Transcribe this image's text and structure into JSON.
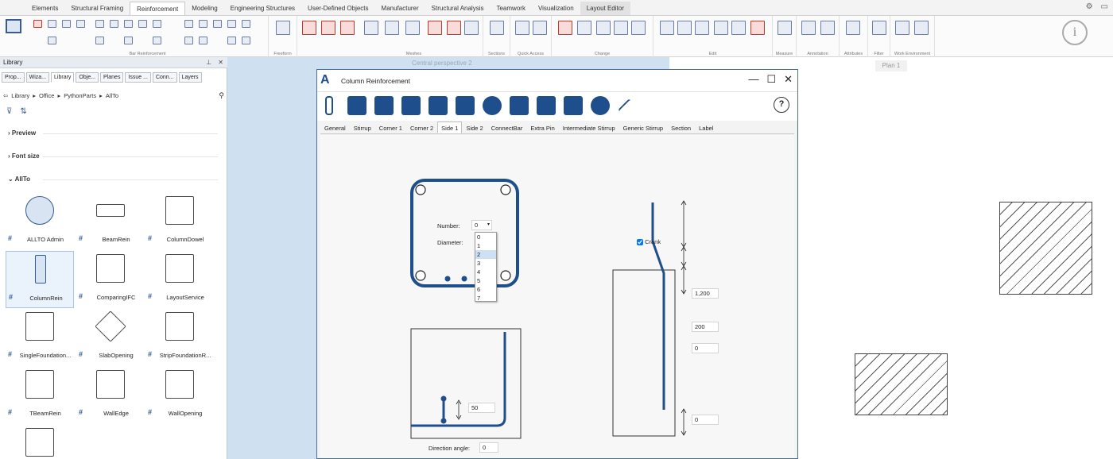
{
  "ribbon": {
    "tabs": [
      "Elements",
      "Structural Framing",
      "Reinforcement",
      "Modeling",
      "Engineering Structures",
      "User-Defined Objects",
      "Manufacturer",
      "Structural Analysis",
      "Teamwork",
      "Visualization",
      "Layout Editor"
    ],
    "active_tab": "Reinforcement",
    "groups": [
      "Bar Reinforcement",
      "Freeform",
      "Meshes",
      "Sections",
      "Quick Access",
      "Change",
      "Edit",
      "Measure",
      "Annotation",
      "Attributes",
      "Filter",
      "Work Environment"
    ]
  },
  "library": {
    "title": "Library",
    "tabs": [
      "Prop...",
      "Wiza...",
      "Library",
      "Obje...",
      "Planes",
      "Issue ...",
      "Conn...",
      "Layers"
    ],
    "path": [
      "Library",
      "Office",
      "PythonParts",
      "AllTo"
    ],
    "sections": [
      "Preview",
      "Font size",
      "AllTo"
    ],
    "items": [
      "ALLTO Admin",
      "BeamRein",
      "ColumnDowel",
      "ColumnRein",
      "ComparingIFC",
      "LayoutService",
      "SingleFoundation...",
      "SlabOpening",
      "StripFoundationR...",
      "TBeamRein",
      "WallEdge",
      "WallOpening"
    ],
    "selected_item": "ColumnRein"
  },
  "viewport": {
    "top_label": "Central perspective 2",
    "plan_tag": "Plan 1"
  },
  "dialog": {
    "title": "Column Reinforcement",
    "tabs": [
      "General",
      "Stirrup",
      "Corner 1",
      "Corner 2",
      "Side 1",
      "Side 2",
      "ConnectBar",
      "Extra Pin",
      "Intermediate Stirrup",
      "Generic Stirrup",
      "Section",
      "Label"
    ],
    "active_tab": "Side 1",
    "help": "?",
    "number_label": "Number:",
    "number_value": "0",
    "diameter_label": "Diameter:",
    "dropdown_options": [
      "0",
      "1",
      "2",
      "3",
      "4",
      "5",
      "6",
      "7"
    ],
    "hovered_option": "2",
    "crank_label": "Crank",
    "crank_checked": true,
    "dim_1200": "1,200",
    "dim_200": "200",
    "dim_0a": "0",
    "dim_50": "50",
    "dim_0b": "0",
    "direction_angle_label": "Direction angle:",
    "direction_angle_value": "0"
  },
  "colors": {
    "accent": "#1f4e8c",
    "panel_blue": "#cfe0f1",
    "dialog_border": "#4a6fa5"
  }
}
